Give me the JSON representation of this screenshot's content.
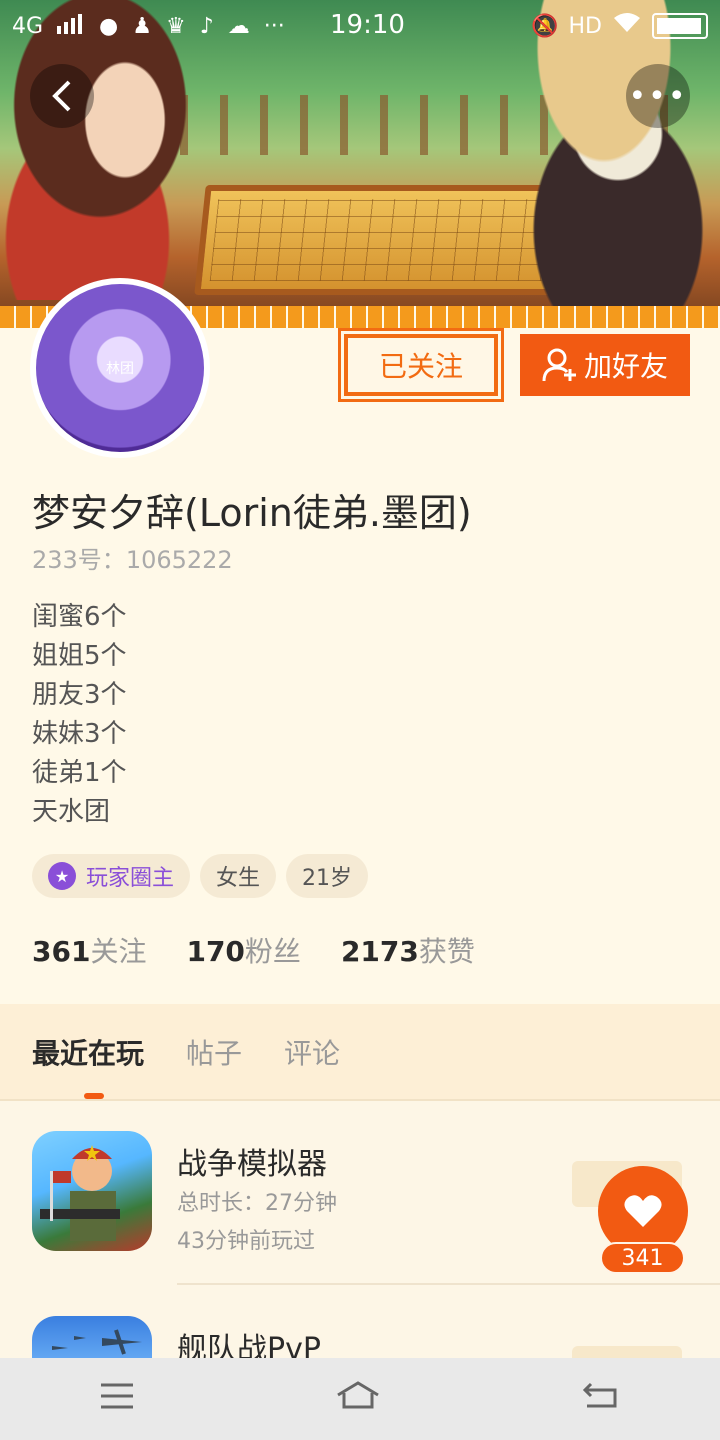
{
  "status_bar": {
    "network": "4G",
    "time": "19:10",
    "hd": "HD",
    "dots": "···"
  },
  "header": {
    "back_icon": "chevron-left-icon",
    "more_icon": "more-dots-icon"
  },
  "profile": {
    "avatar_text": "林团",
    "follow_label": "已关注",
    "add_friend_label": "加好友",
    "nickname": "梦安夕辞(Lorin徒弟.墨团)",
    "uid_label": "233号：",
    "uid": "1065222",
    "bio_lines": [
      "闺蜜6个",
      "姐姐5个",
      "朋友3个",
      "妹妹3个",
      "徒弟1个",
      "天水团"
    ],
    "tags": [
      {
        "label": "玩家圈主",
        "icon": "star-badge-icon"
      },
      {
        "label": "女生"
      },
      {
        "label": "21岁"
      }
    ],
    "stats": [
      {
        "value": "361",
        "label": "关注"
      },
      {
        "value": "170",
        "label": "粉丝"
      },
      {
        "value": "2173",
        "label": "获赞"
      }
    ]
  },
  "tabs": [
    "最近在玩",
    "帖子",
    "评论"
  ],
  "games": [
    {
      "title": "战争模拟器",
      "duration": "总时长：27分钟",
      "last_played": "43分钟前玩过"
    },
    {
      "title": "舰队战PvP"
    }
  ],
  "like": {
    "count": "341",
    "icon": "heart-icon"
  },
  "navbar": {
    "menu_icon": "menu-icon",
    "home_icon": "home-icon",
    "back_icon": "back-arrow-icon"
  },
  "colors": {
    "accent": "#f25a12",
    "badge": "#8a4fd8",
    "background": "#fdf6e6"
  }
}
